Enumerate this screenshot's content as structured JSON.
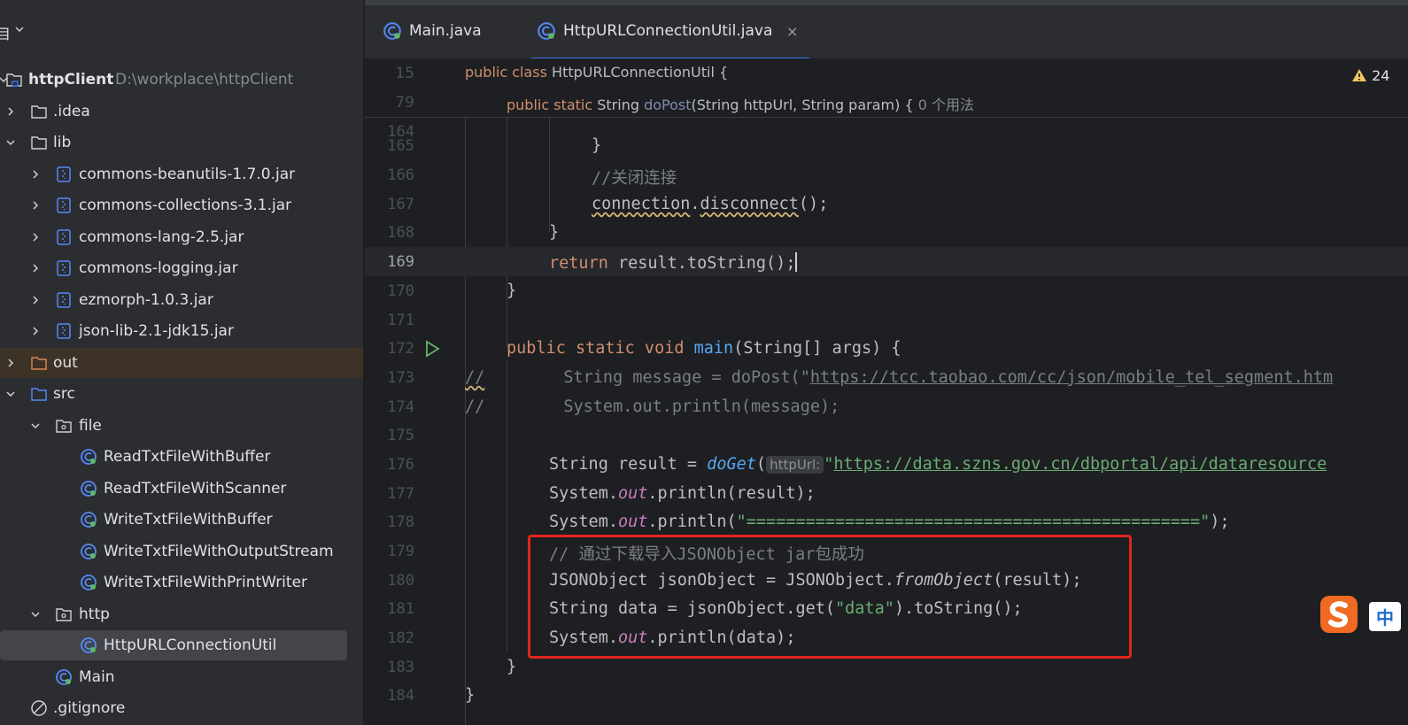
{
  "sidebar": {
    "title": "目",
    "project": {
      "name": "httpClient",
      "path": "D:\\workplace\\httpClient"
    },
    "items": [
      {
        "label": ".idea"
      },
      {
        "label": "lib"
      },
      {
        "label": "commons-beanutils-1.7.0.jar"
      },
      {
        "label": "commons-collections-3.1.jar"
      },
      {
        "label": "commons-lang-2.5.jar"
      },
      {
        "label": "commons-logging.jar"
      },
      {
        "label": "ezmorph-1.0.3.jar"
      },
      {
        "label": "json-lib-2.1-jdk15.jar"
      },
      {
        "label": "out"
      },
      {
        "label": "src"
      },
      {
        "label": "file"
      },
      {
        "label": "ReadTxtFileWithBuffer"
      },
      {
        "label": "ReadTxtFileWithScanner"
      },
      {
        "label": "WriteTxtFileWithBuffer"
      },
      {
        "label": "WriteTxtFileWithOutputStream"
      },
      {
        "label": "WriteTxtFileWithPrintWriter"
      },
      {
        "label": "http"
      },
      {
        "label": "HttpURLConnectionUtil"
      },
      {
        "label": "Main"
      },
      {
        "label": ".gitignore"
      }
    ]
  },
  "tabs": [
    {
      "label": "Main.java"
    },
    {
      "label": "HttpURLConnectionUtil.java",
      "close": "×"
    }
  ],
  "warnings": {
    "count": "24"
  },
  "ime": {
    "label": "中"
  },
  "sticky": [
    {
      "num": "15",
      "t": {
        "a": "public class ",
        "b": "HttpURLConnectionUtil {"
      }
    },
    {
      "num": "79",
      "t": {
        "a": "public static ",
        "b": "String ",
        "c": "doPost",
        "d": "(String httpUrl, String param) {",
        "e": "0 个用法"
      }
    }
  ],
  "lines": {
    "l164": "164",
    "l165": {
      "num": "165",
      "text": "}"
    },
    "l166": {
      "num": "166",
      "text": "//关闭连接"
    },
    "l167": {
      "num": "167",
      "a": "connection",
      "b": ".",
      "c": "disconnect",
      "d": "();"
    },
    "l168": {
      "num": "168",
      "text": "}"
    },
    "l169": {
      "num": "169",
      "a": "return ",
      "b": "result.toString();"
    },
    "l170": {
      "num": "170",
      "text": "}"
    },
    "l171": {
      "num": "171"
    },
    "l172": {
      "num": "172",
      "a": "public static void ",
      "b": "main",
      "c": "(String[] args) {"
    },
    "l173": {
      "num": "173",
      "a": "//",
      "b": "        String message = doPost(\"",
      "c": "https://tcc.taobao.com/cc/json/mobile_tel_segment.htm"
    },
    "l174": {
      "num": "174",
      "a": "//",
      "b": "        System.out.println(message);"
    },
    "l175": {
      "num": "175"
    },
    "l176": {
      "num": "176",
      "a": "String result = ",
      "b": "doGet",
      "c": "(",
      "hint": "httpUrl:",
      "d": "\"",
      "e": "https://data.szns.gov.cn/dbportal/api/dataresource"
    },
    "l177": {
      "num": "177",
      "a": "System.",
      "b": "out",
      "c": ".println(result);"
    },
    "l178": {
      "num": "178",
      "a": "System.",
      "b": "out",
      "c": ".println(",
      "d": "\"==============================================\"",
      "e": ");"
    },
    "l179": {
      "num": "179",
      "text": "// 通过下载导入JSONObject jar包成功"
    },
    "l180": {
      "num": "180",
      "a": "JSONObject jsonObject = JSONObject.",
      "b": "fromObject",
      "c": "(result);"
    },
    "l181": {
      "num": "181",
      "a": "String data = jsonObject.get(",
      "b": "\"data\"",
      "c": ").toString();"
    },
    "l182": {
      "num": "182",
      "a": "System.",
      "b": "out",
      "c": ".println(data);"
    },
    "l183": {
      "num": "183",
      "text": "}"
    },
    "l184": {
      "num": "184",
      "text": "}"
    }
  },
  "colors": {
    "keyword": "#cf8e6d",
    "method": "#56a8f5",
    "string": "#6aab73",
    "comment": "#7a7e85",
    "static_field": "#c77dbb",
    "highlight_box": "#e3251e",
    "accent": "#3574f0"
  }
}
